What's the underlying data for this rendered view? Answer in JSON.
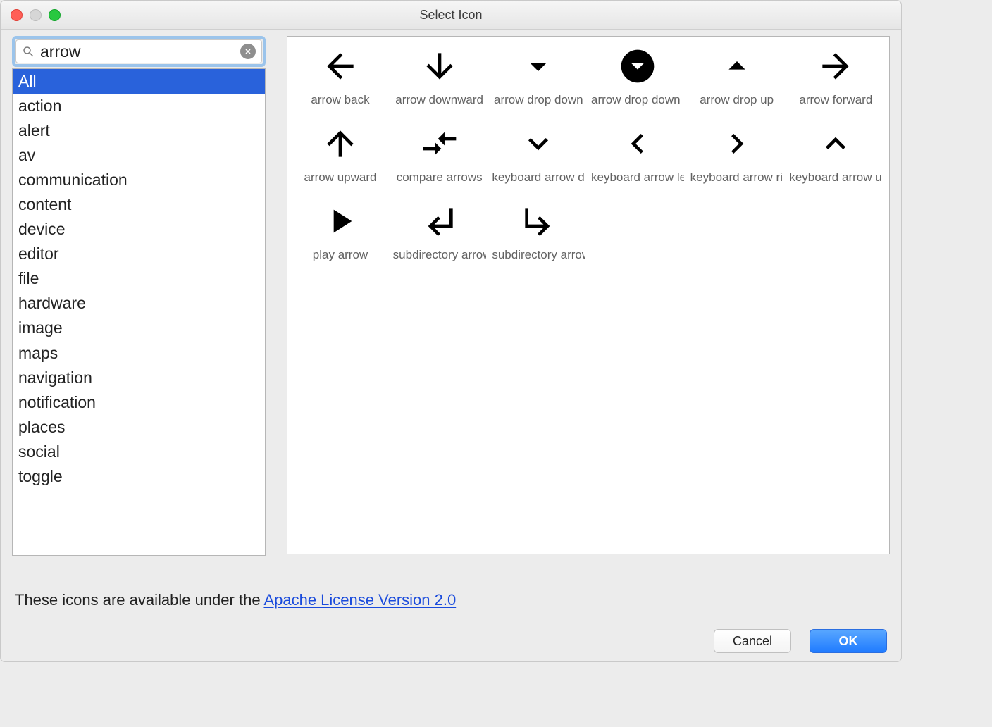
{
  "window": {
    "title": "Select Icon"
  },
  "search": {
    "value": "arrow"
  },
  "categories": {
    "selected_index": 0,
    "items": [
      "All",
      "action",
      "alert",
      "av",
      "communication",
      "content",
      "device",
      "editor",
      "file",
      "hardware",
      "image",
      "maps",
      "navigation",
      "notification",
      "places",
      "social",
      "toggle"
    ]
  },
  "icons": [
    {
      "id": "arrow-back",
      "label": "arrow back"
    },
    {
      "id": "arrow-downward",
      "label": "arrow downward"
    },
    {
      "id": "arrow-drop-down",
      "label": "arrow drop down"
    },
    {
      "id": "arrow-drop-down-circle",
      "label": "arrow drop down circle"
    },
    {
      "id": "arrow-drop-up",
      "label": "arrow drop up"
    },
    {
      "id": "arrow-forward",
      "label": "arrow forward"
    },
    {
      "id": "arrow-upward",
      "label": "arrow upward"
    },
    {
      "id": "compare-arrows",
      "label": "compare arrows"
    },
    {
      "id": "keyboard-arrow-down",
      "label": "keyboard arrow down"
    },
    {
      "id": "keyboard-arrow-left",
      "label": "keyboard arrow left"
    },
    {
      "id": "keyboard-arrow-right",
      "label": "keyboard arrow right"
    },
    {
      "id": "keyboard-arrow-up",
      "label": "keyboard arrow up"
    },
    {
      "id": "play-arrow",
      "label": "play arrow"
    },
    {
      "id": "subdirectory-arrow-left",
      "label": "subdirectory arrow left"
    },
    {
      "id": "subdirectory-arrow-right",
      "label": "subdirectory arrow right"
    }
  ],
  "footer": {
    "license_prefix": "These icons are available under the ",
    "license_link": "Apache License Version 2.0",
    "cancel": "Cancel",
    "ok": "OK"
  }
}
